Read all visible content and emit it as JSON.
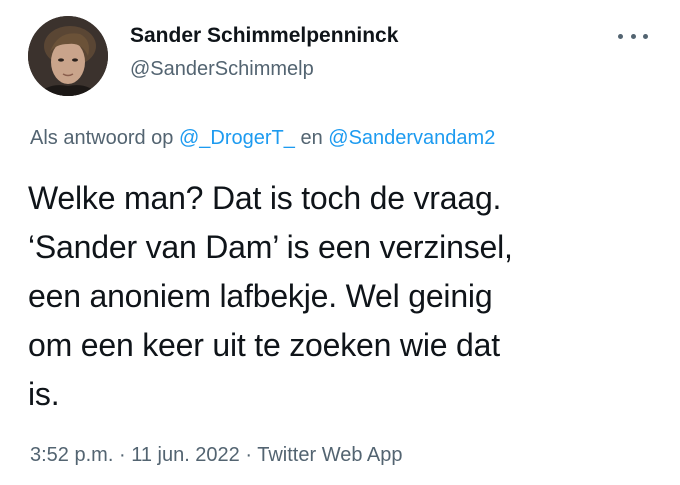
{
  "author": {
    "name": "Sander Schimmelpenninck",
    "handle": "@SanderSchimmelp"
  },
  "reply": {
    "prefix": "Als antwoord op",
    "mention_1": "@_DrogerT_",
    "conjunction": "en",
    "mention_2": "@Sandervandam2"
  },
  "tweet": {
    "lines": [
      "Welke man? Dat is toch de vraag.",
      "‘Sander van Dam’ is een verzinsel,",
      "een anoniem lafbekje. Wel geinig",
      "om een keer uit te zoeken wie dat",
      "is."
    ]
  },
  "meta": {
    "time": "3:52 p.m.",
    "separator": "·",
    "date": "11 jun. 2022",
    "app": "Twitter Web App"
  },
  "icons": {
    "more": "more-horizontal-icon"
  },
  "colors": {
    "text": "#0f1419",
    "secondary": "#536471",
    "link": "#1d9bf0"
  }
}
